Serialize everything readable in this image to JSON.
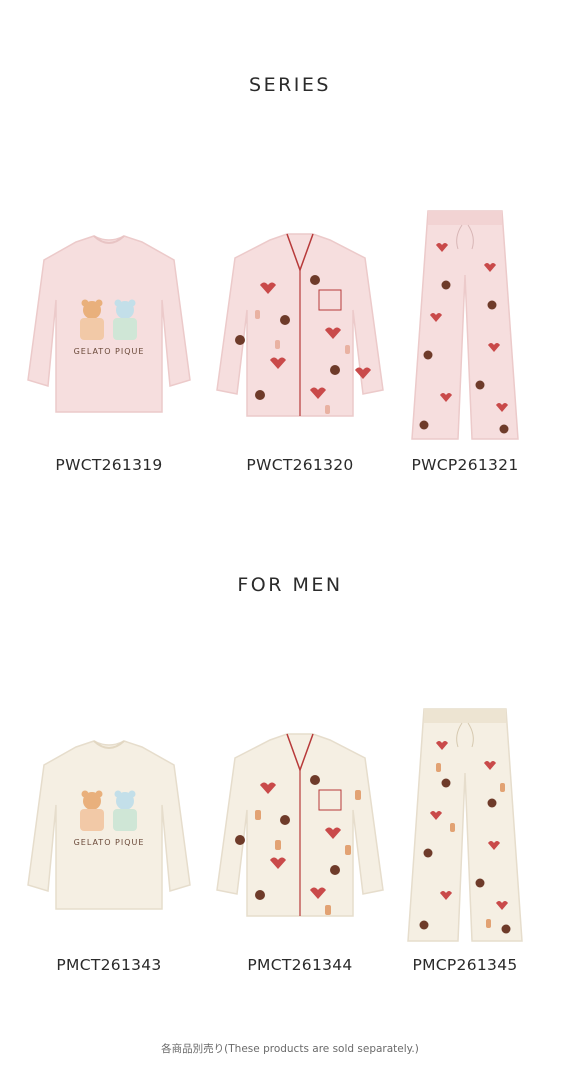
{
  "series": {
    "title": "SERIES",
    "products": [
      {
        "code": "PWCT261319",
        "image_label": "GELATO PIQUE",
        "item": "women-long-sleeve-tee"
      },
      {
        "code": "PWCT261320",
        "image_label": "",
        "item": "women-pajama-shirt"
      },
      {
        "code": "PWCP261321",
        "image_label": "",
        "item": "women-pajama-pants"
      }
    ]
  },
  "men": {
    "title": "FOR MEN",
    "products": [
      {
        "code": "PMCT261343",
        "image_label": "GELATO PIQUE",
        "item": "men-long-sleeve-tee"
      },
      {
        "code": "PMCT261344",
        "image_label": "",
        "item": "men-pajama-shirt"
      },
      {
        "code": "PMCP261345",
        "image_label": "",
        "item": "men-pajama-pants"
      }
    ]
  },
  "footnote": "各商品別売り(These products are sold separately.)",
  "colors": {
    "women_fabric": "#f6dede",
    "women_fabric_shadow": "#eccaca",
    "men_fabric": "#f5efe3",
    "men_fabric_shadow": "#e6ddcc",
    "heart": "#c94a4a",
    "chocolate": "#6e3b2a",
    "bear": "#e2a273",
    "piping": "#b73a3a"
  }
}
